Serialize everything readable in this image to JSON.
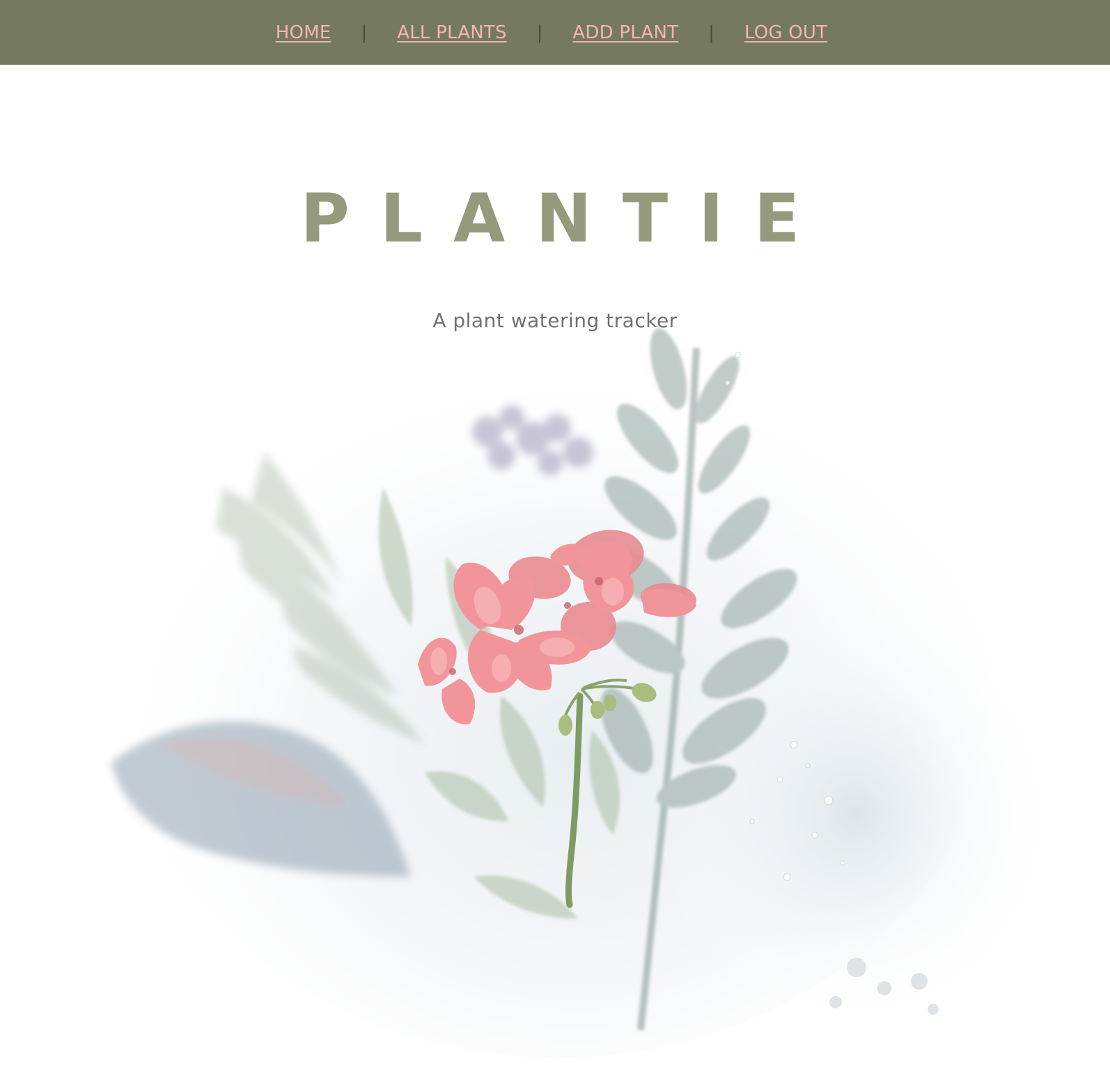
{
  "nav": {
    "items": [
      {
        "label": "HOME"
      },
      {
        "label": "ALL PLANTS"
      },
      {
        "label": "ADD PLANT"
      },
      {
        "label": "LOG OUT"
      }
    ],
    "separator": "|"
  },
  "hero": {
    "title": "PLANTIE",
    "tagline": "A plant watering tracker",
    "image": "pink-geranium-with-foliage-illustration"
  },
  "colors": {
    "nav_background": "#75795e",
    "nav_link": "#f4b5b5",
    "title": "#949a7b",
    "tagline": "#707070"
  }
}
